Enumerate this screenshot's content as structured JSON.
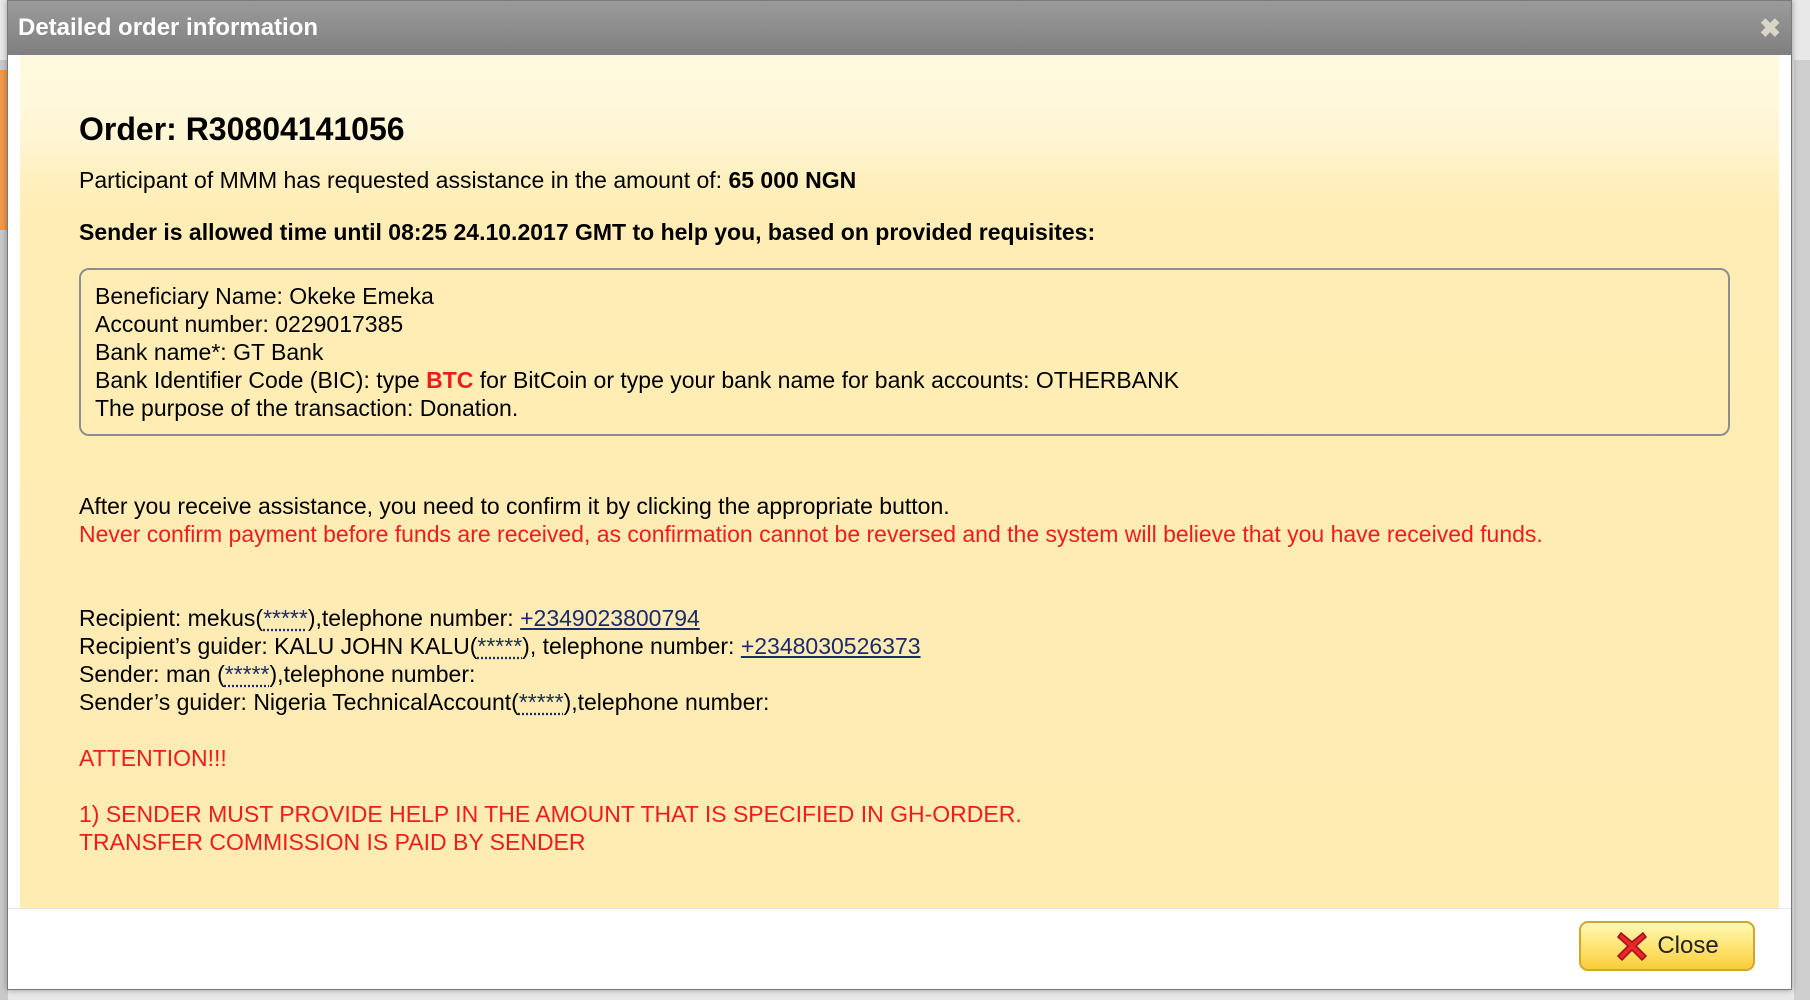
{
  "dialog": {
    "title": "Detailed order information",
    "close_x": "✖"
  },
  "order": {
    "title": "Order: R30804141056",
    "amount_prefix": "Participant of MMM has requested assistance in the amount of: ",
    "amount_value": "65 000 NGN",
    "deadline": "Sender is allowed time until 08:25 24.10.2017 GMT to help you, based on provided requisites:"
  },
  "requisites": {
    "beneficiary": "Beneficiary Name: Okeke Emeka",
    "account": "Account number: 0229017385",
    "bank": "Bank name*: GT Bank",
    "bic_prefix": "Bank Identifier Code (BIC): type ",
    "bic_btc": "BTC",
    "bic_suffix": " for BitCoin or type your bank name for bank accounts: OTHERBANK",
    "purpose": "The purpose of the transaction: Donation."
  },
  "confirm": {
    "instruction": "After you receive assistance, you need to confirm it by clicking the appropriate button.",
    "warning": "Never confirm payment before funds are received, as confirmation cannot be reversed and the system will believe that you have received funds."
  },
  "contacts": {
    "recipient_prefix": "Recipient: mekus(",
    "recipient_mask": "*****",
    "recipient_mid": "),telephone number: ",
    "recipient_phone": "+2349023800794",
    "guider_prefix": "Recipient’s guider: KALU JOHN KALU(",
    "guider_mask": "*****",
    "guider_mid": "), telephone number: ",
    "guider_phone": "+2348030526373",
    "sender_prefix": "Sender: man (",
    "sender_mask": "*****",
    "sender_suffix": "),telephone number:",
    "sender_guider_prefix": "Sender’s guider: Nigeria TechnicalAccount(",
    "sender_guider_mask": "*****",
    "sender_guider_suffix": "),telephone number:"
  },
  "attention": {
    "heading": "ATTENTION!!!",
    "line1": "1) SENDER MUST PROVIDE HELP IN THE AMOUNT THAT IS SPECIFIED IN GH-ORDER.",
    "line2": "TRANSFER COMMISSION IS PAID BY SENDER"
  },
  "footer": {
    "close_label": "Close"
  },
  "colors": {
    "warning_red": "#ef1c1c",
    "link_blue": "#1a2a6c",
    "panel_yellow": "#ffecb3"
  }
}
